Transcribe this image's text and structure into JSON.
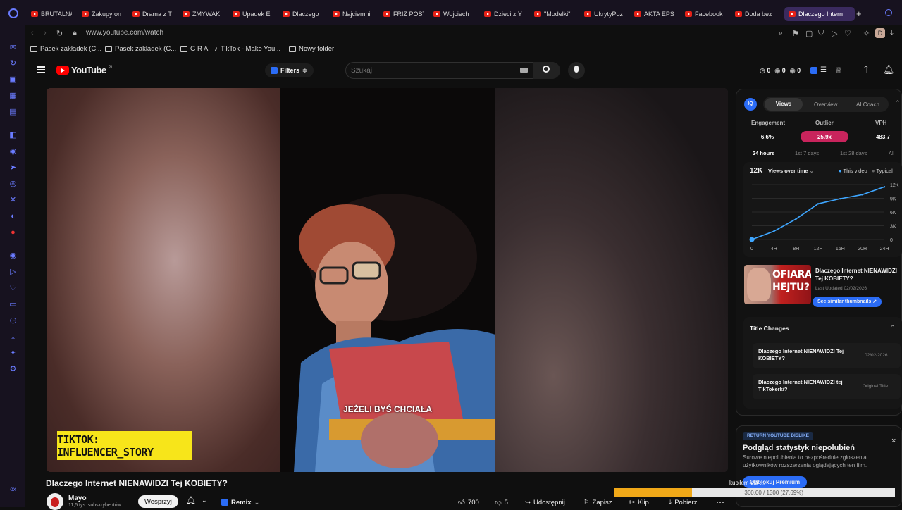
{
  "tabs": [
    {
      "label": "BRUTALNA"
    },
    {
      "label": "Zakupy on"
    },
    {
      "label": "Drama z T"
    },
    {
      "label": "ZMYWAK"
    },
    {
      "label": "Upadek E"
    },
    {
      "label": "Dlaczego"
    },
    {
      "label": "Najciemni"
    },
    {
      "label": "FRIZ POST"
    },
    {
      "label": "Wojciech"
    },
    {
      "label": "Dzieci z Y"
    },
    {
      "label": "\"Modelki\""
    },
    {
      "label": "UkrytyPoz"
    },
    {
      "label": "AKTA EPS"
    },
    {
      "label": "Facebook"
    },
    {
      "label": "Doda bez"
    },
    {
      "label": "Dlaczego Intern"
    }
  ],
  "address": {
    "url": "www.youtube.com/watch",
    "profile_initial": "D"
  },
  "bookmarks": [
    {
      "label": "Pasek zakładek (C..."
    },
    {
      "label": "Pasek zakładek (C..."
    },
    {
      "label": "G R A"
    },
    {
      "label": "TikTok - Make You..."
    },
    {
      "label": "Nowy folder"
    }
  ],
  "yt": {
    "logo_text": "YouTube",
    "region": "PL",
    "filters_label": "Filters",
    "search_placeholder": "Szukaj",
    "counters": [
      "0",
      "0",
      "0"
    ]
  },
  "video": {
    "badge_text": "TIKTOK: INFLUENCER_STORY",
    "caption": "JEŻELI BYŚ CHCIAŁA",
    "title": "Dlaczego Internet NIENAWIDZI Tej KOBIETY?",
    "channel": "Mayo",
    "subscribers": "11,5 tys. subskrybentów",
    "support_label": "Wesprzyj",
    "remix_label": "Remix",
    "likes": "700",
    "dislikes": "5",
    "share_label": "Udostępnij",
    "save_label": "Zapisz",
    "clip_label": "Klip",
    "download_label": "Pobierz"
  },
  "vidiq": {
    "tabs": [
      "Views",
      "Overview",
      "AI Coach"
    ],
    "stats": [
      {
        "label": "Engagement",
        "value": "6.6%"
      },
      {
        "label": "Outlier",
        "value": "25.9x"
      },
      {
        "label": "VPH",
        "value": "483.7"
      }
    ],
    "ranges": [
      "24 hours",
      "1st 7 days",
      "1st 28 days",
      "All"
    ],
    "chart_header": {
      "total": "12K",
      "metric": "Views over time",
      "legend_this": "This video",
      "legend_typical": "Typical"
    },
    "thumb_text": [
      "OFIARA",
      "HEJTU?"
    ],
    "thumb_title": "Dlaczego Internet NIENAWIDZI Tej KOBIETY?",
    "thumb_updated": "Last Updated 02/02/2026",
    "similar_label": "See similar thumbnails",
    "title_changes_heading": "Title Changes",
    "title_changes": [
      {
        "title": "Dlaczego Internet NIENAWIDZI Tej KOBIETY?",
        "date": "02/02/2026"
      },
      {
        "title": "Dlaczego Internet NIENAWIDZI tej TikTokerki?",
        "date": "Original Title"
      }
    ]
  },
  "dislike_panel": {
    "badge": "RETURN YOUTUBE DISLIKE",
    "heading": "Podgląd statystyk niepolubień",
    "body": "Surowe niepolubienia to bezpośrednie zgłoszenia użytkowników rozszerzenia oglądających ten film.",
    "button": "Odblokuj Premium",
    "close": "×"
  },
  "progress": {
    "label": "kupiłem-dla-...",
    "text": "360.00 / 1300 (27.69%)",
    "fraction": 0.2769
  },
  "chart_data": {
    "type": "line",
    "title": "Views over time",
    "x": [
      "0",
      "4H",
      "8H",
      "12H",
      "16H",
      "20H",
      "24H"
    ],
    "series": [
      {
        "name": "This video",
        "values": [
          0,
          1800,
          4500,
          7800,
          8900,
          9800,
          11500
        ]
      }
    ],
    "yticks": [
      "12K",
      "9K",
      "6K",
      "3K",
      "0"
    ],
    "ylim": [
      0,
      12000
    ],
    "legend": "top-right",
    "colors": {
      "this_video": "#3ea6ff",
      "typical": "#555555"
    }
  }
}
